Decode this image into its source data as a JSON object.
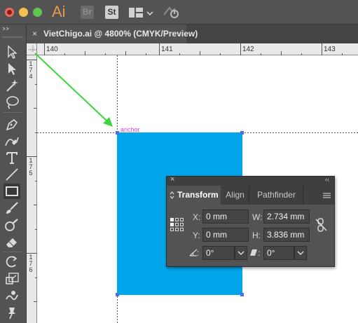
{
  "app": {
    "logo": "Ai",
    "bridge_label": "Br",
    "stock_label": "St"
  },
  "document_tab": {
    "close_glyph": "×",
    "title": "VietChigo.ai @ 4800% (CMYK/Preview)"
  },
  "ruler": {
    "horizontal": [
      "140",
      "141",
      "142",
      "143"
    ],
    "vertical": [
      [
        "1",
        "7",
        "4"
      ],
      [
        "1",
        "7",
        "5"
      ],
      [
        "1",
        "7",
        "6"
      ]
    ]
  },
  "canvas": {
    "anchor_label": "anchor",
    "shape_color": "#00a5ea",
    "arrow_color": "#3bd63b"
  },
  "transform_panel": {
    "tabs": [
      "Transform",
      "Align",
      "Pathfinder"
    ],
    "x_label": "X:",
    "x_value": "0 mm",
    "y_label": "Y:",
    "y_value": "0 mm",
    "w_label": "W:",
    "w_value": "2.734 mm",
    "h_label": "H:",
    "h_value": "3.836 mm",
    "rotate_label": ":",
    "rotate_value": "0°",
    "shear_label": ":",
    "shear_value": "0°"
  },
  "colors": {
    "accent_pink": "#e03ee0",
    "anchor_blue": "#4f6fe6",
    "ai_logo": "#e89a55"
  },
  "icons": {
    "tools": [
      "selection-tool-icon",
      "direct-selection-tool-icon",
      "magic-wand-icon",
      "lasso-icon",
      "pen-tool-icon",
      "curvature-tool-icon",
      "type-tool-icon",
      "line-tool-icon",
      "rectangle-tool-icon",
      "paintbrush-icon",
      "blob-brush-icon",
      "eraser-icon",
      "rotate-tool-icon",
      "scale-tool-icon",
      "warp-tool-icon",
      "pin-tool-icon"
    ]
  }
}
